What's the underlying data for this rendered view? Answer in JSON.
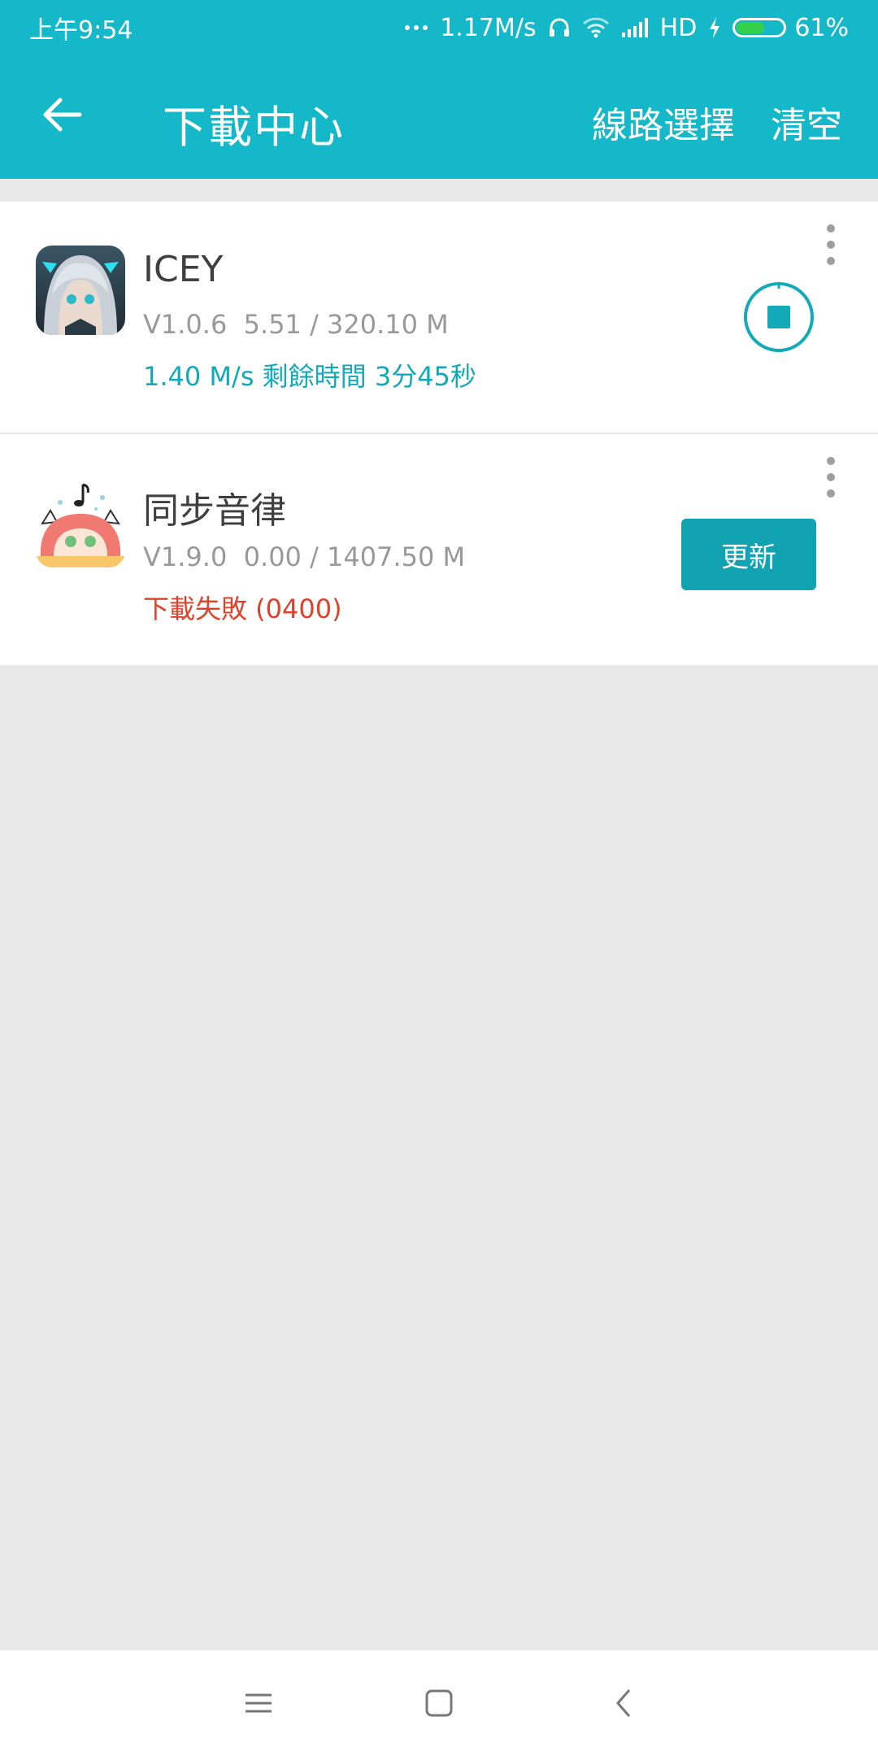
{
  "status_bar": {
    "time": "上午9:54",
    "net_speed": "1.17M/s",
    "network_type": "HD",
    "battery": "61%",
    "battery_level": 0.61,
    "icons": [
      "more-dots-icon",
      "headphones-icon",
      "wifi-icon",
      "signal-icon",
      "charging-icon",
      "battery-icon"
    ]
  },
  "app_bar": {
    "title": "下載中心",
    "route_label": "線路選擇",
    "clear_label": "清空",
    "back_icon": "arrow-left-icon"
  },
  "downloads": [
    {
      "name": "ICEY",
      "meta": "V1.0.6  5.51 / 320.10 M",
      "status": "1.40 M/s  剩餘時間 3分45秒",
      "status_color": "#12a9b8",
      "action_icon": "stop-icon"
    },
    {
      "name": "同步音律",
      "meta": "V1.9.0  0.00 / 1407.50 M",
      "status": "下載失敗 (0400)",
      "status_color": "#e0412b",
      "action_label": "更新"
    }
  ],
  "nav_bar": {
    "icons": [
      "menu-icon",
      "home-icon",
      "back-icon"
    ]
  },
  "colors": {
    "accent": "#14b8c8",
    "button": "#12a3b2",
    "error": "#e0412b",
    "background": "#e8e8e8"
  }
}
